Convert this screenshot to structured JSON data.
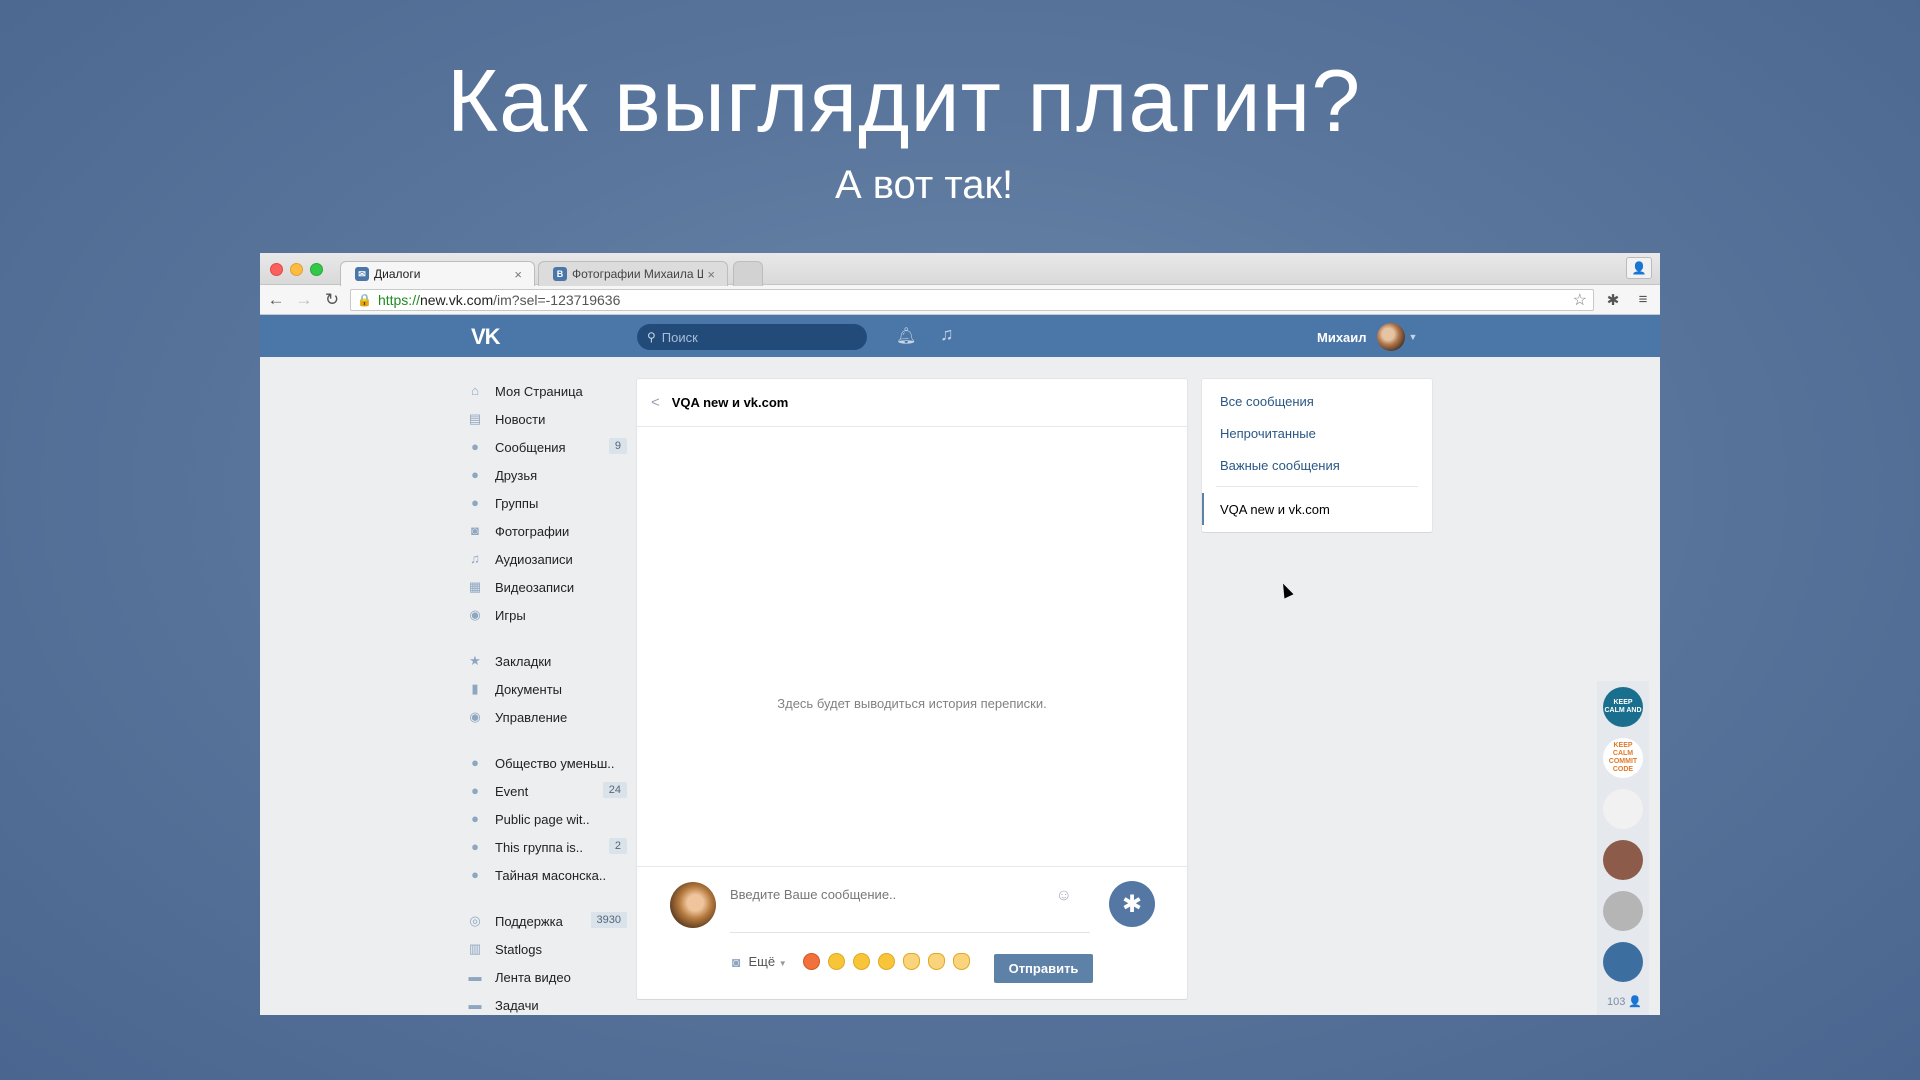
{
  "slide": {
    "title": "Как выглядит плагин?",
    "subtitle": "А вот так!"
  },
  "browser": {
    "tabs": [
      {
        "label": "Диалоги",
        "favicon": "vk-messages-icon"
      },
      {
        "label": "Фотографии Михаила Ше"
      }
    ],
    "url": {
      "scheme": "https://",
      "host": "new.vk.com",
      "path": "/im?sel=-123719636"
    }
  },
  "vk": {
    "logo": "VK",
    "search_placeholder": "Поиск",
    "user_name": "Михаил"
  },
  "sidebar": {
    "items": [
      {
        "label": "Моя Страница",
        "icon": "home-icon",
        "glyph": "⌂",
        "count": ""
      },
      {
        "label": "Новости",
        "icon": "news-icon",
        "glyph": "▤",
        "count": ""
      },
      {
        "label": "Сообщения",
        "icon": "messages-icon",
        "glyph": "●",
        "count": "9"
      },
      {
        "label": "Друзья",
        "icon": "friend-icon",
        "glyph": "●",
        "count": ""
      },
      {
        "label": "Группы",
        "icon": "groups-icon",
        "glyph": "●",
        "count": ""
      },
      {
        "label": "Фотографии",
        "icon": "camera-icon",
        "glyph": "◙",
        "count": ""
      },
      {
        "label": "Аудиозаписи",
        "icon": "music-icon",
        "glyph": "♫",
        "count": ""
      },
      {
        "label": "Видеозаписи",
        "icon": "film-icon",
        "glyph": "▦",
        "count": ""
      },
      {
        "label": "Игры",
        "icon": "gamepad-icon",
        "glyph": "◉",
        "count": ""
      }
    ],
    "items2": [
      {
        "label": "Закладки",
        "icon": "star-icon",
        "glyph": "★",
        "count": ""
      },
      {
        "label": "Документы",
        "icon": "document-icon",
        "glyph": "▮",
        "count": ""
      },
      {
        "label": "Управление",
        "icon": "gamepad-icon",
        "glyph": "◉",
        "count": ""
      }
    ],
    "items3": [
      {
        "label": "Общество уменьш..",
        "icon": "groups-icon",
        "glyph": "●",
        "count": ""
      },
      {
        "label": "Event",
        "icon": "groups-icon",
        "glyph": "●",
        "count": "24"
      },
      {
        "label": "Public page wit..",
        "icon": "groups-icon",
        "glyph": "●",
        "count": ""
      },
      {
        "label": "This группа is..",
        "icon": "groups-icon",
        "glyph": "●",
        "count": "2"
      },
      {
        "label": "Тайная масонска..",
        "icon": "groups-icon",
        "glyph": "●",
        "count": ""
      }
    ],
    "items4": [
      {
        "label": "Поддержка",
        "icon": "support-icon",
        "glyph": "◎",
        "count": "3930"
      },
      {
        "label": "Statlogs",
        "icon": "stats-icon",
        "glyph": "▥",
        "count": ""
      },
      {
        "label": "Лента видео",
        "icon": "video-feed-icon",
        "glyph": "▬",
        "count": ""
      },
      {
        "label": "Задачи",
        "icon": "tasks-icon",
        "glyph": "▬",
        "count": ""
      }
    ]
  },
  "chat": {
    "title": "VQA new и vk.com",
    "empty_text": "Здесь будет выводиться история переписки.",
    "input_placeholder": "Введите Ваше сообщение..",
    "more_label": "Ещё",
    "send_label": "Отправить"
  },
  "right_menu": {
    "items": [
      "Все сообщения",
      "Непрочитанные",
      "Важные сообщения"
    ],
    "active": "VQA new и vk.com"
  },
  "rail": {
    "avatars": [
      {
        "text": "KEEP CALM AND",
        "bg": "#1b6f8e",
        "fg": "#ffffff"
      },
      {
        "text": "KEEP CALM COMMIT CODE",
        "bg": "#ffffff",
        "fg": "#e07a2a"
      },
      {
        "text": "",
        "bg": "#f1f1f1",
        "fg": "#999999"
      },
      {
        "text": "",
        "bg": "#8c5b4a",
        "fg": "#ffffff"
      },
      {
        "text": "",
        "bg": "#b5b5b5",
        "fg": "#ffffff"
      },
      {
        "text": "",
        "bg": "#3c6ea0",
        "fg": "#ffffff"
      }
    ],
    "online_count": "103"
  },
  "colors": {
    "vk_blue": "#4a76a8",
    "send_button": "#5e81a8",
    "background": "#5a769c"
  }
}
